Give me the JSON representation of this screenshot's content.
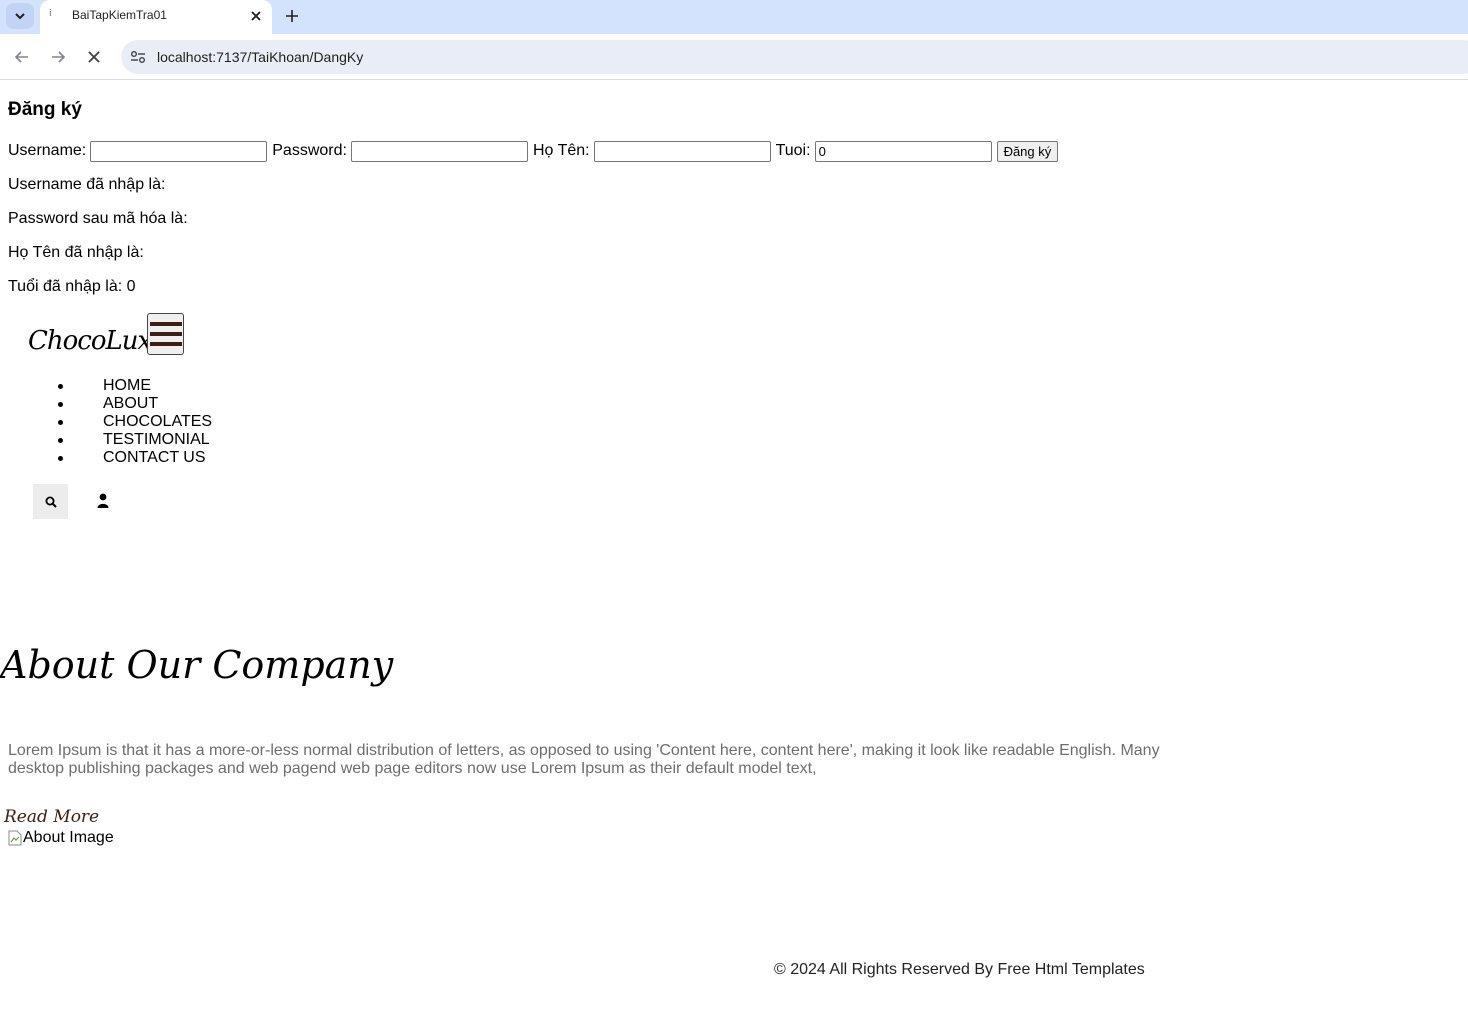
{
  "browser": {
    "tab_title": "BaiTapKiemTra01",
    "favicon": "i",
    "url": "localhost:7137/TaiKhoan/DangKy"
  },
  "page": {
    "title": "Đăng ký",
    "form": {
      "username_label": "Username:",
      "username_value": "",
      "password_label": "Password:",
      "password_value": "",
      "hoten_label": "Họ Tên:",
      "hoten_value": "",
      "tuoi_label": "Tuoi:",
      "tuoi_value": "0",
      "submit_label": "Đăng ký"
    },
    "results": {
      "username": "Username đã nhập là:",
      "password": "Password sau mã hóa là:",
      "hoten": "Họ Tên đã nhập là:",
      "tuoi": "Tuổi đã nhập là: 0"
    },
    "brand": "ChocoLux",
    "nav": [
      "HOME",
      "ABOUT",
      "CHOCOLATES",
      "TESTIMONIAL",
      "CONTACT US"
    ],
    "icons": {
      "search": "search-icon",
      "user": "user-icon",
      "menu": "hamburger-icon"
    },
    "about": {
      "heading": "About Our Company",
      "text": "Lorem Ipsum is that it has a more-or-less normal distribution of letters, as opposed to using 'Content here, content here', making it look like readable English. Many desktop publishing packages and web pagend web page editors now use Lorem Ipsum as their default model text,",
      "read_more": "Read More",
      "image_alt": "About Image"
    },
    "footer": "© 2024 All Rights Reserved By Free Html Templates",
    "colors": {
      "brand_brown": "#3d1e10",
      "tabstrip": "#d3e3fd",
      "omnibox": "#e9eef6",
      "muted_text": "#6d6d6d"
    }
  }
}
